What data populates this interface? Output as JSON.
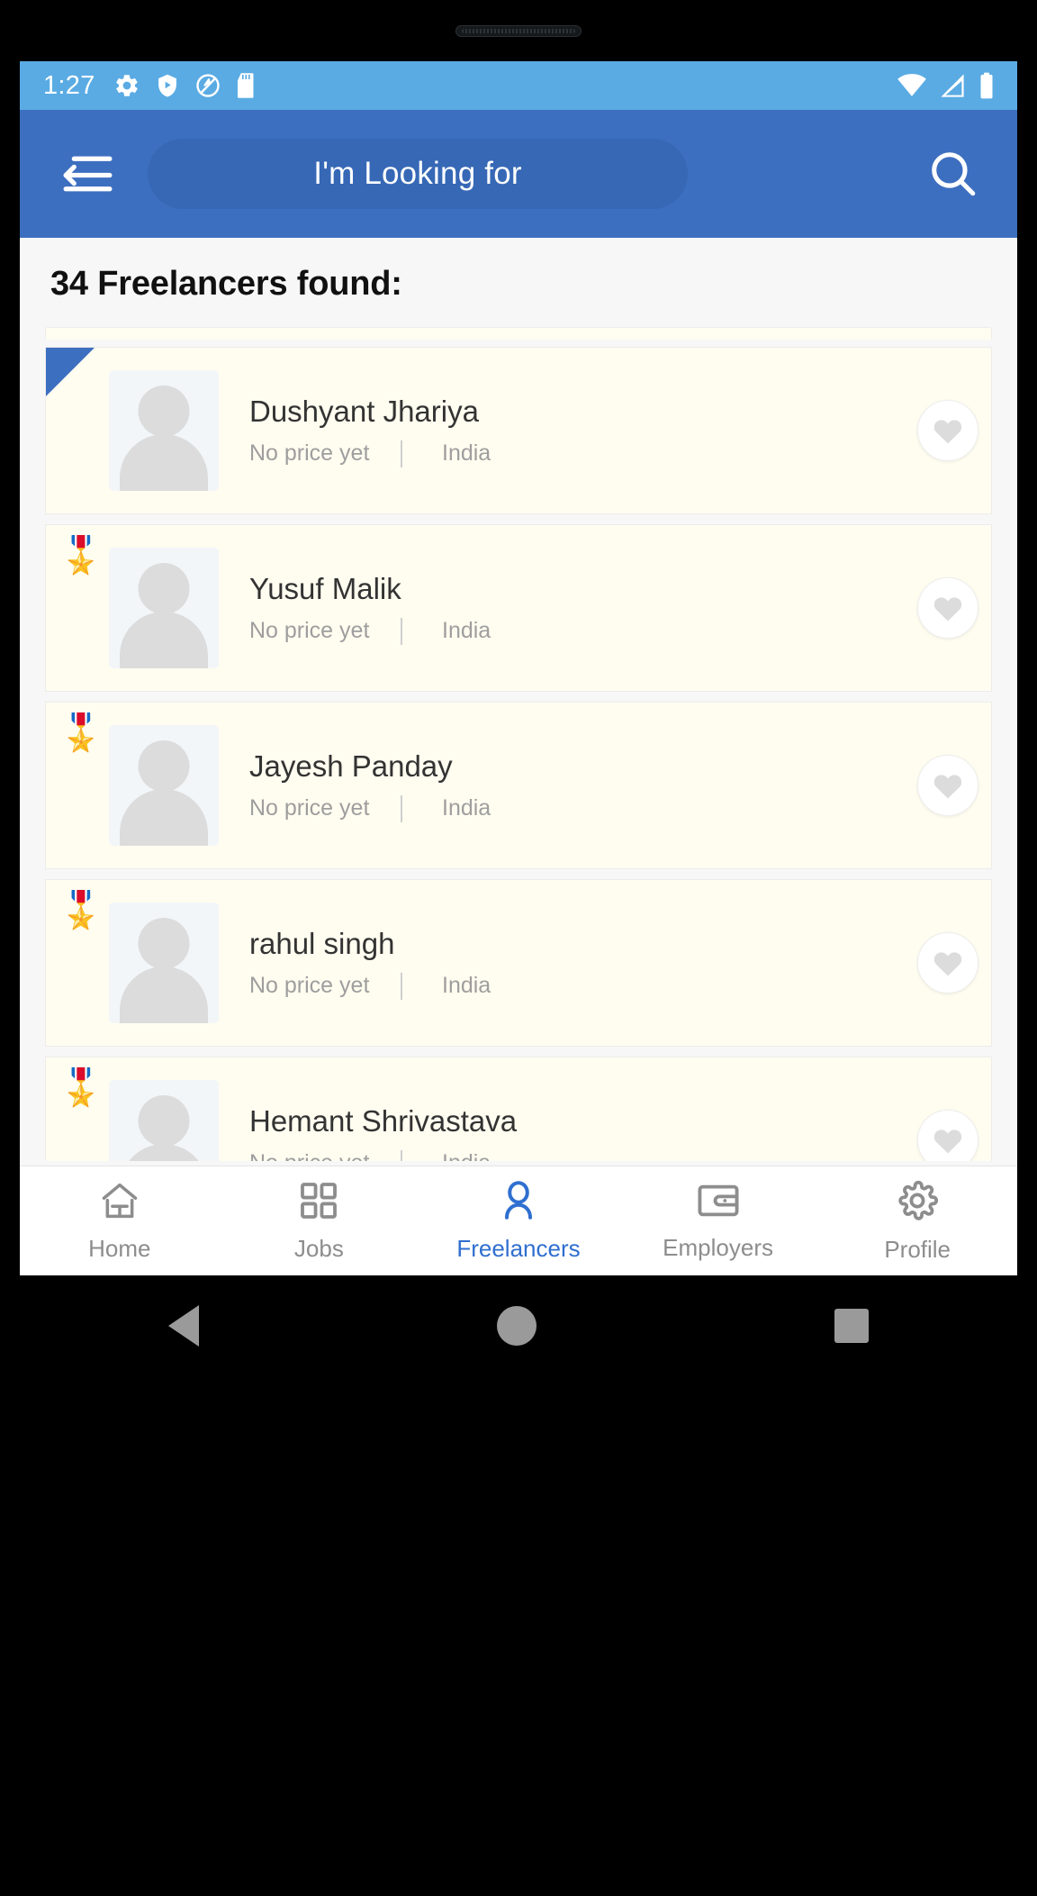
{
  "status_bar": {
    "time": "1:27",
    "left_icons": [
      "settings-gear-icon",
      "shield-play-icon",
      "circle-slash-icon",
      "sd-card-icon"
    ],
    "right_icons": [
      "wifi-icon",
      "cell-signal-icon",
      "battery-icon"
    ],
    "background_color": "#5aabe3"
  },
  "app_bar": {
    "menu_icon": "menu-back-icon",
    "search_pill_label": "I'm Looking for",
    "search_icon": "search-icon",
    "background_color": "#3d6fc0",
    "pill_color": "#3668b6"
  },
  "results": {
    "heading": "34 Freelancers found:",
    "count": 34,
    "card_background": "#fffdf0",
    "cards": [
      {
        "name": "Dushyant Jhariya",
        "price": "No price yet",
        "location": "India",
        "badge": "corner-triangle",
        "favorite_icon": "heart-icon",
        "favorited": false
      },
      {
        "name": "Yusuf Malik",
        "price": "No price yet",
        "location": "India",
        "badge": "medal",
        "favorite_icon": "heart-icon",
        "favorited": false
      },
      {
        "name": "Jayesh Panday",
        "price": "No price yet",
        "location": "India",
        "badge": "medal",
        "favorite_icon": "heart-icon",
        "favorited": false
      },
      {
        "name": "rahul singh",
        "price": "No price yet",
        "location": "India",
        "badge": "medal",
        "favorite_icon": "heart-icon",
        "favorited": false
      },
      {
        "name": "Hemant  Shrivastava",
        "price": "No price yet",
        "location": "India",
        "badge": "medal",
        "favorite_icon": "heart-icon",
        "favorited": false
      }
    ],
    "medal_glyph": "🎖️"
  },
  "bottom_nav": {
    "active_color": "#2f6fd0",
    "inactive_color": "#8d8d8d",
    "items": [
      {
        "label": "Home",
        "icon": "home-icon",
        "active": false
      },
      {
        "label": "Jobs",
        "icon": "grid-squares-icon",
        "active": false
      },
      {
        "label": "Freelancers",
        "icon": "person-icon",
        "active": true
      },
      {
        "label": "Employers",
        "icon": "wallet-icon",
        "active": false
      },
      {
        "label": "Profile",
        "icon": "gear-icon",
        "active": false
      }
    ]
  },
  "system_nav": {
    "back": "back-triangle-icon",
    "home": "home-circle-icon",
    "recents": "recents-square-icon"
  }
}
